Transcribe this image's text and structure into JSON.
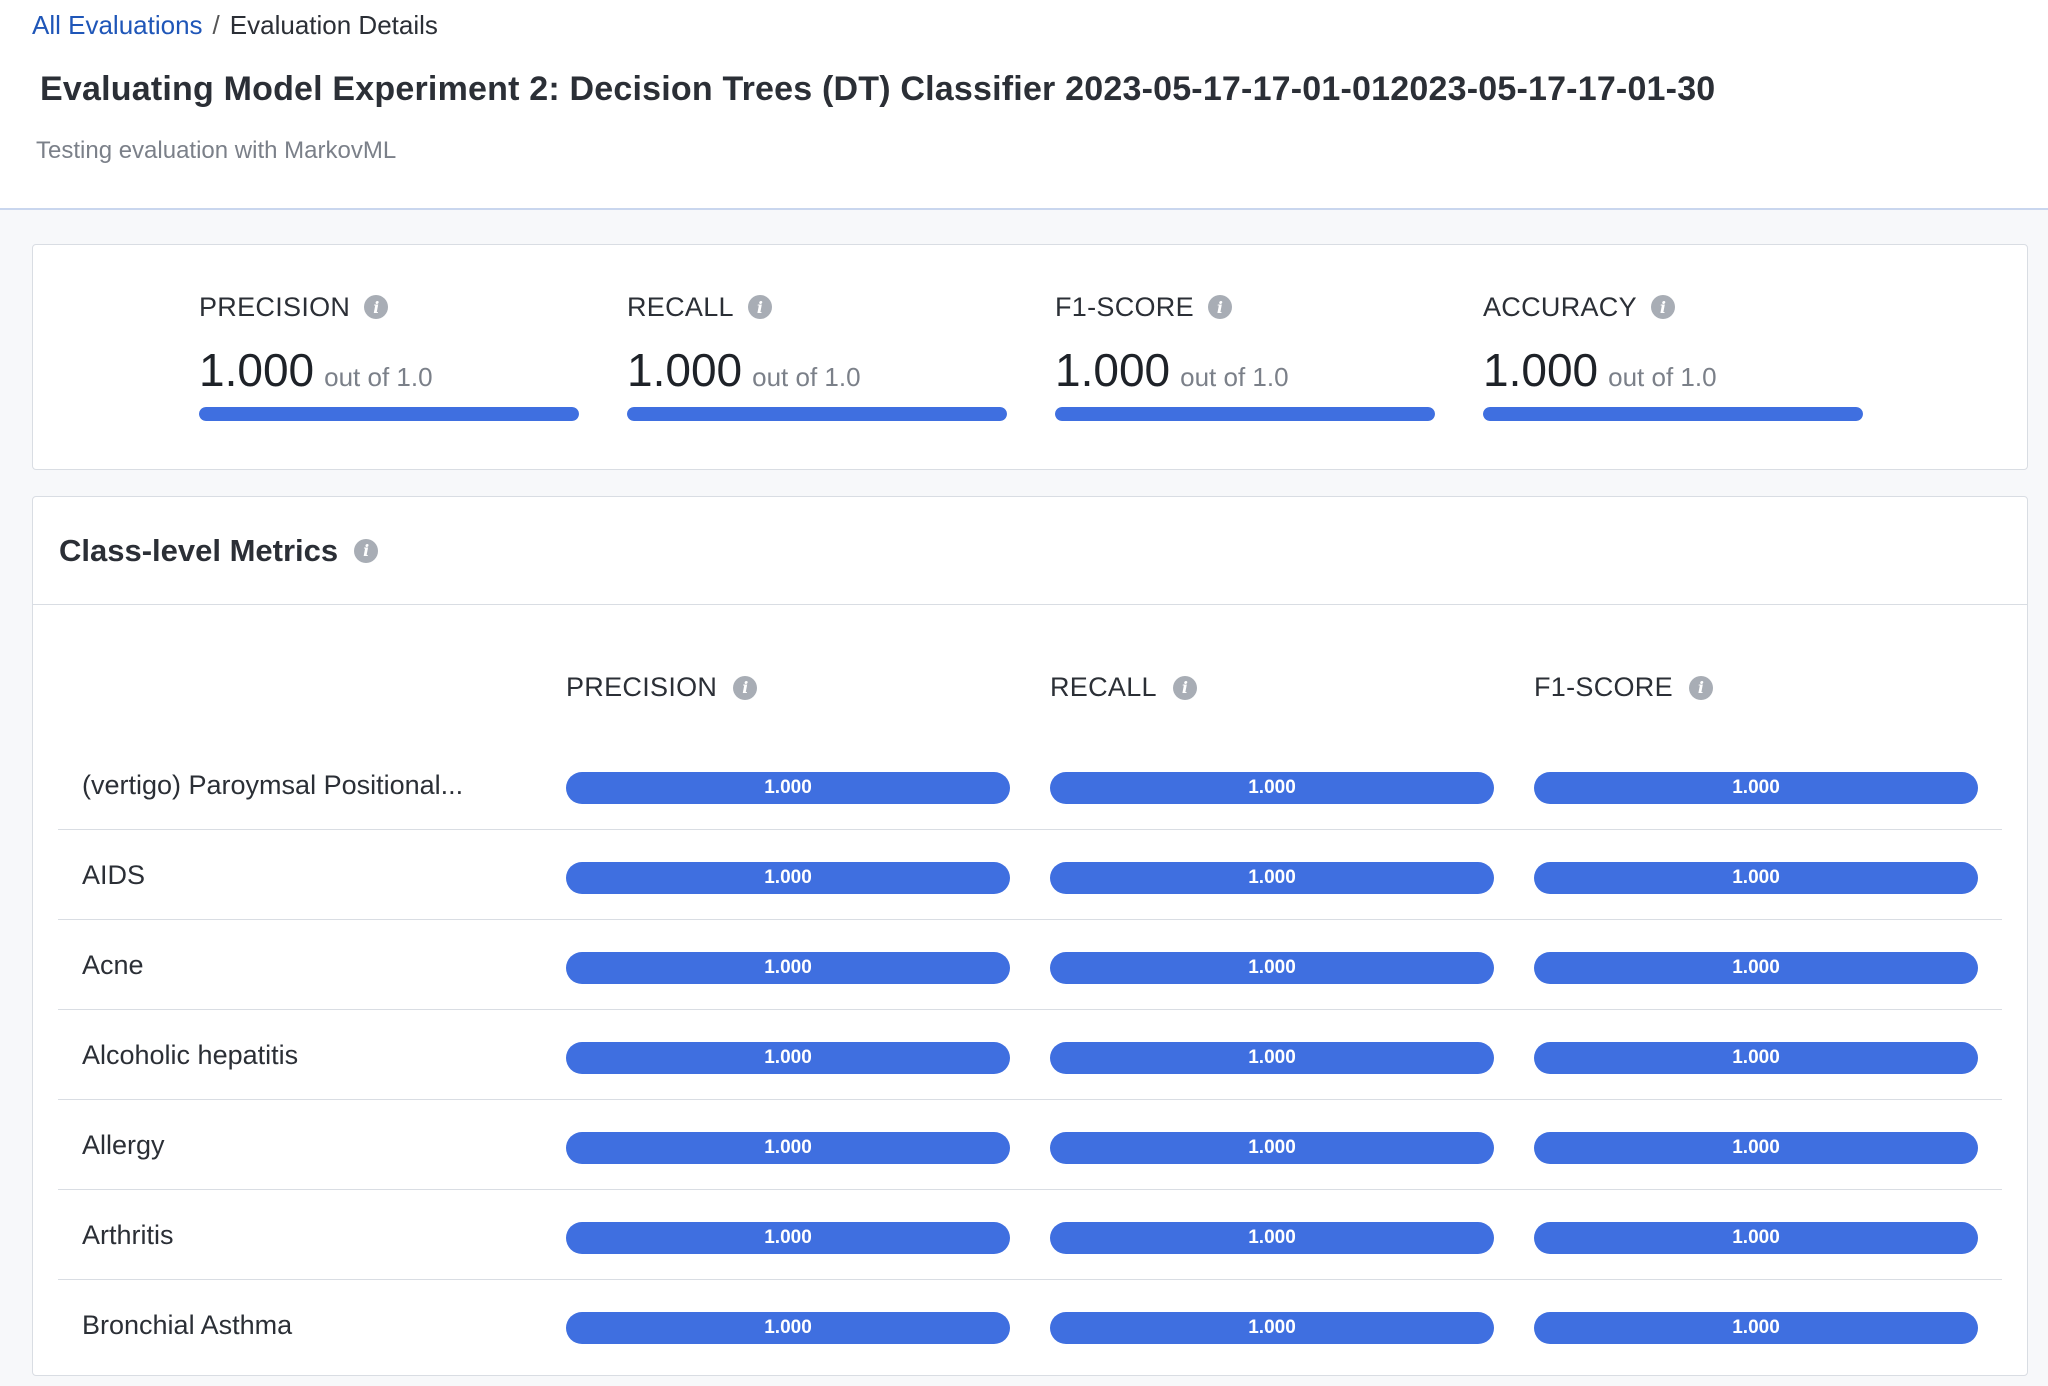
{
  "breadcrumb": {
    "link": "All Evaluations",
    "separator": "/",
    "current": "Evaluation Details"
  },
  "page": {
    "title": "Evaluating Model Experiment 2: Decision Trees (DT) Classifier 2023-05-17-17-01-012023-05-17-17-01-30",
    "subtitle": "Testing evaluation with MarkovML"
  },
  "icons": {
    "info": "info-icon"
  },
  "colors": {
    "accent": "#3f6fe0",
    "link": "#1f56b8"
  },
  "summary": [
    {
      "label": "PRECISION",
      "value": "1.000",
      "out_of": "out of 1.0",
      "fraction": 1.0
    },
    {
      "label": "RECALL",
      "value": "1.000",
      "out_of": "out of 1.0",
      "fraction": 1.0
    },
    {
      "label": "F1-SCORE",
      "value": "1.000",
      "out_of": "out of 1.0",
      "fraction": 1.0
    },
    {
      "label": "ACCURACY",
      "value": "1.000",
      "out_of": "out of 1.0",
      "fraction": 1.0
    }
  ],
  "class_metrics": {
    "title": "Class-level Metrics",
    "columns": [
      "PRECISION",
      "RECALL",
      "F1-SCORE"
    ],
    "rows": [
      {
        "name": "(vertigo) Paroymsal Positional...",
        "precision": "1.000",
        "recall": "1.000",
        "f1": "1.000"
      },
      {
        "name": "AIDS",
        "precision": "1.000",
        "recall": "1.000",
        "f1": "1.000"
      },
      {
        "name": "Acne",
        "precision": "1.000",
        "recall": "1.000",
        "f1": "1.000"
      },
      {
        "name": "Alcoholic hepatitis",
        "precision": "1.000",
        "recall": "1.000",
        "f1": "1.000"
      },
      {
        "name": "Allergy",
        "precision": "1.000",
        "recall": "1.000",
        "f1": "1.000"
      },
      {
        "name": "Arthritis",
        "precision": "1.000",
        "recall": "1.000",
        "f1": "1.000"
      },
      {
        "name": "Bronchial Asthma",
        "precision": "1.000",
        "recall": "1.000",
        "f1": "1.000"
      }
    ]
  }
}
